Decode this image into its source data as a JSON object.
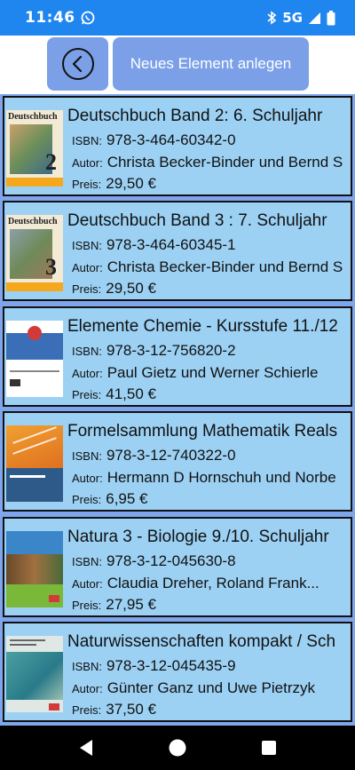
{
  "status_bar": {
    "time": "11:46",
    "network": "5G"
  },
  "toolbar": {
    "new_element_label": "Neues Element anlegen"
  },
  "labels": {
    "isbn": "ISBN:",
    "author": "Autor:",
    "price": "Preis:"
  },
  "books": [
    {
      "title": "Deutschbuch Band 2: 6. Schuljahr",
      "isbn": "978-3-464-60342-0",
      "author": "Christa Becker-Binder und Bernd S",
      "price": "29,50 €",
      "cover_text": "Deutschbuch",
      "cover_number": "2"
    },
    {
      "title": "Deutschbuch Band 3 : 7. Schuljahr",
      "isbn": "978-3-464-60345-1",
      "author": "Christa Becker-Binder und Bernd S",
      "price": "29,50 €",
      "cover_text": "Deutschbuch",
      "cover_number": "3"
    },
    {
      "title": "Elemente Chemie - Kursstufe 11./12",
      "isbn": "978-3-12-756820-2",
      "author": "Paul Gietz und Werner Schierle",
      "price": "41,50 €"
    },
    {
      "title": "Formelsammlung Mathematik Reals",
      "isbn": "978-3-12-740322-0",
      "author": "Hermann D Hornschuh und Norbe",
      "price": "6,95 €"
    },
    {
      "title": "Natura 3 - Biologie 9./10. Schuljahr",
      "isbn": "978-3-12-045630-8",
      "author": "Claudia Dreher, Roland Frank...",
      "price": "27,95 €"
    },
    {
      "title": "Naturwissenschaften kompakt / Sch",
      "isbn": "978-3-12-045435-9",
      "author": "Günter Ganz und Uwe Pietrzyk",
      "price": "37,50 €"
    }
  ]
}
